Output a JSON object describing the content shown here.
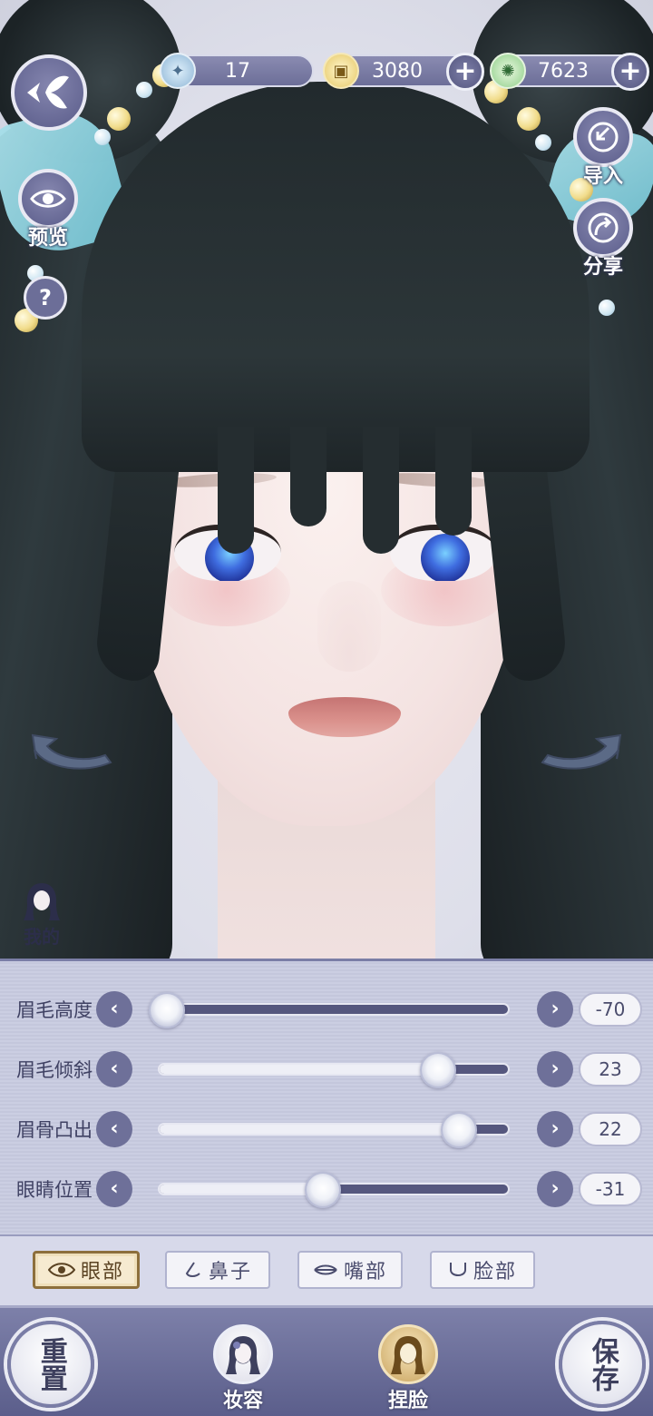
{
  "currencies": [
    {
      "name": "jade",
      "value": "17",
      "icon": "jade-coin-icon",
      "has_plus": false
    },
    {
      "name": "coins",
      "value": "3080",
      "icon": "copper-coin-icon",
      "has_plus": true
    },
    {
      "name": "tokens",
      "value": "7623",
      "icon": "spiral-token-icon",
      "has_plus": true
    }
  ],
  "left_buttons": {
    "preview_label": "预览",
    "help_label": "?",
    "mine_label": "我的"
  },
  "right_buttons": {
    "import_label": "导入",
    "share_label": "分享"
  },
  "sliders": [
    {
      "label": "眉毛高度",
      "value": "-70",
      "fraction": 0.02
    },
    {
      "label": "眉毛倾斜",
      "value": "23",
      "fraction": 0.8
    },
    {
      "label": "眉骨凸出",
      "value": "22",
      "fraction": 0.86
    },
    {
      "label": "眼睛位置",
      "value": "-31",
      "fraction": 0.47
    }
  ],
  "tabs": [
    {
      "label": "眼部",
      "icon": "eye-icon",
      "active": true
    },
    {
      "label": "鼻子",
      "icon": "nose-icon",
      "active": false
    },
    {
      "label": "嘴部",
      "icon": "mouth-icon",
      "active": false
    },
    {
      "label": "脸部",
      "icon": "face-icon",
      "active": false
    }
  ],
  "bottom": {
    "reset_label": "重置",
    "makeup_label": "妆容",
    "face_label": "捏脸",
    "save_label": "保存"
  },
  "colors": {
    "panel": "#c8cbe0",
    "accent": "#6e7099",
    "active_tab_border": "#8d6f3c"
  }
}
